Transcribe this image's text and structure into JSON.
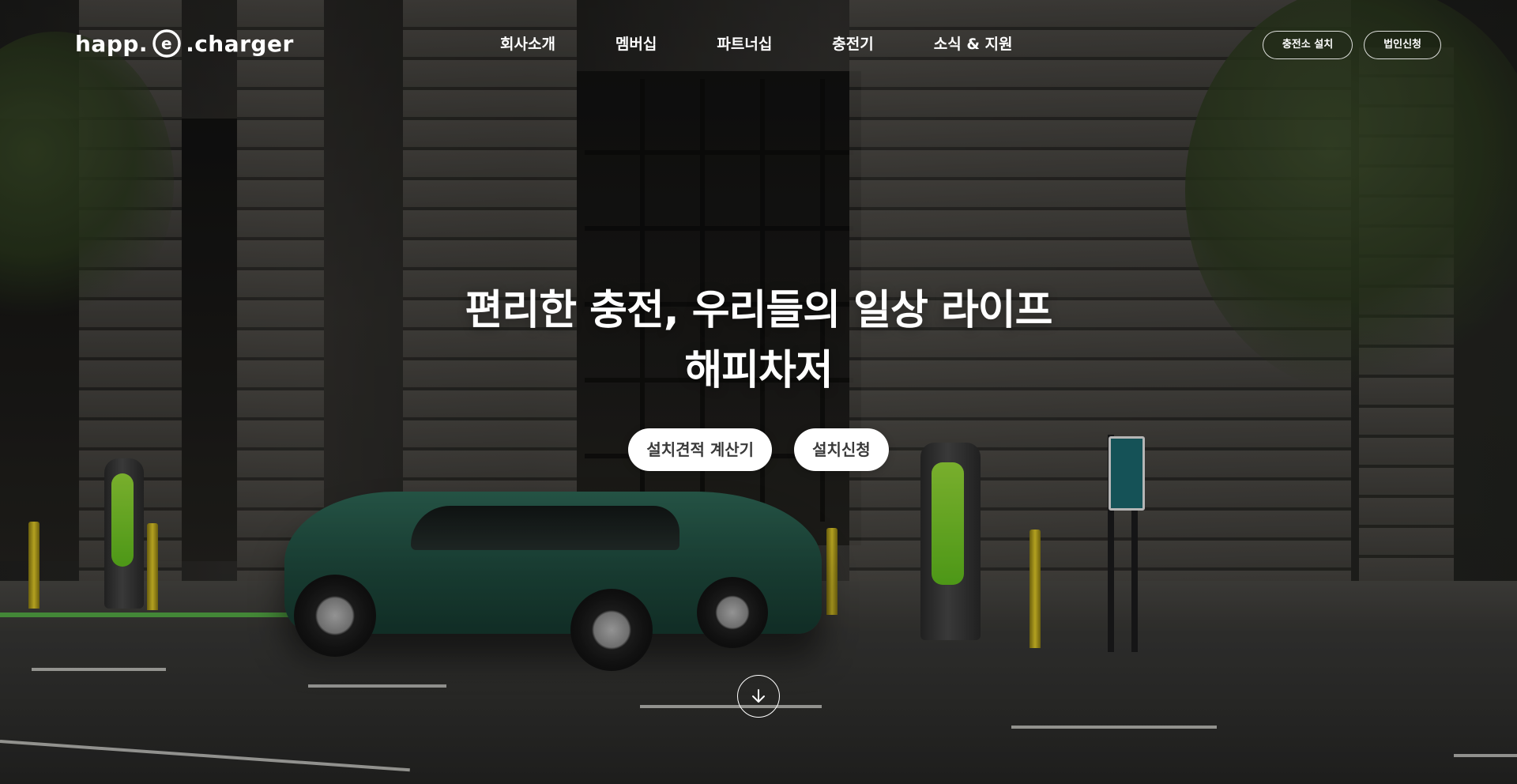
{
  "brand": {
    "logo_left": "happ.",
    "logo_mid": "e",
    "logo_right": ".charger"
  },
  "nav": {
    "items": [
      {
        "label": "회사소개"
      },
      {
        "label": "멤버십"
      },
      {
        "label": "파트너십"
      },
      {
        "label": "충전기"
      },
      {
        "label": "소식 & 지원"
      }
    ]
  },
  "header_buttons": {
    "install": "충전소 설치",
    "corporate": "법인신청"
  },
  "hero": {
    "headline_line1": "편리한 충전, 우리들의 일상 라이프",
    "headline_line2": "해피차저",
    "cta_calculator": "설치견적 계산기",
    "cta_apply": "설치신청"
  },
  "icons": {
    "scroll": "arrow-down-icon",
    "logo_plug": "plug-icon"
  },
  "colors": {
    "text": "#ffffff",
    "cta_bg": "#ffffff",
    "cta_text": "#3a3a3a",
    "accent_green": "#63c21e"
  }
}
